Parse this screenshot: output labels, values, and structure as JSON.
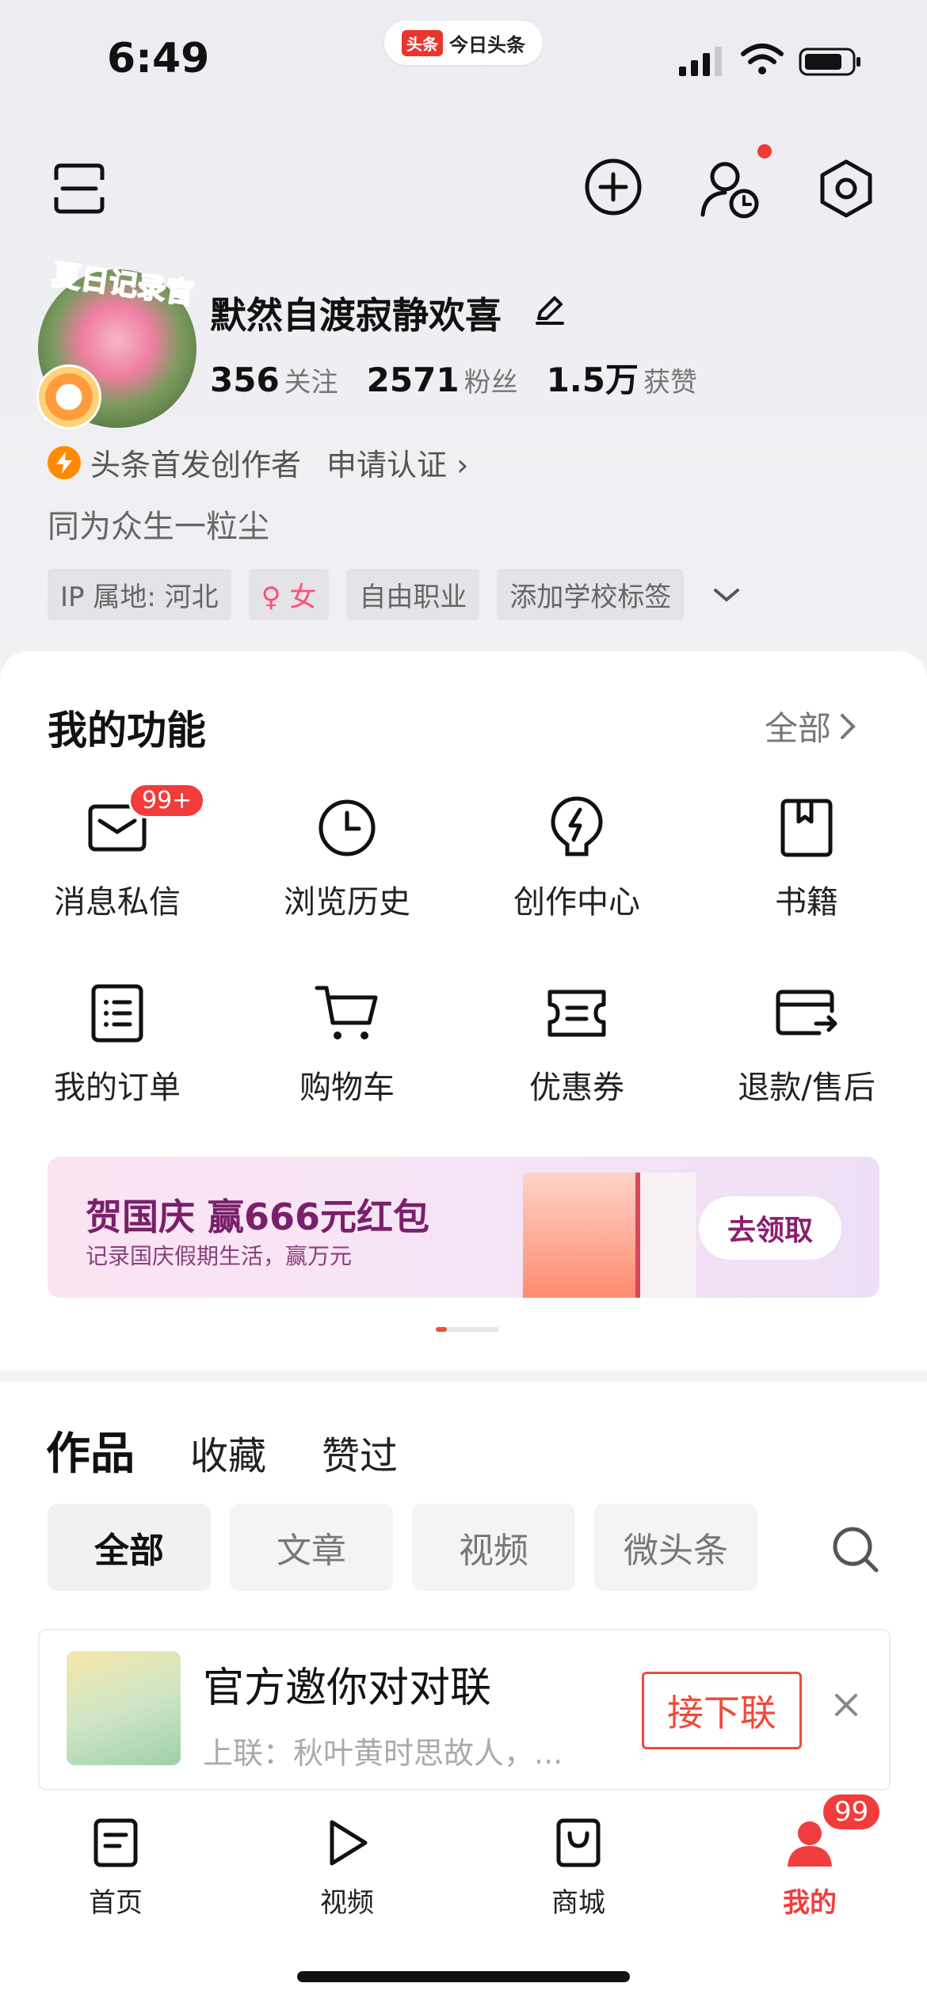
{
  "status_bar": {
    "time": "6:49",
    "app_badge": "头条",
    "app_name": "今日头条"
  },
  "profile": {
    "avatar_text": "夏日记录官",
    "username": "默然自渡寂静欢喜",
    "stats": [
      {
        "value": "356",
        "label": "关注"
      },
      {
        "value": "2571",
        "label": "粉丝"
      },
      {
        "value": "1.5万",
        "label": "获赞"
      }
    ],
    "creator_label": "头条首发创作者",
    "apply_label": "申请认证",
    "bio": "同为众生一粒尘",
    "tags": [
      "IP 属地: 河北",
      "♀ 女",
      "自由职业",
      "添加学校标签"
    ]
  },
  "functions": {
    "title": "我的功能",
    "all_label": "全部",
    "items": [
      {
        "label": "消息私信",
        "icon": "message-icon",
        "badge": "99+"
      },
      {
        "label": "浏览历史",
        "icon": "clock-icon"
      },
      {
        "label": "创作中心",
        "icon": "bolt-bulb-icon"
      },
      {
        "label": "书籍",
        "icon": "book-icon"
      },
      {
        "label": "我的订单",
        "icon": "order-list-icon"
      },
      {
        "label": "购物车",
        "icon": "cart-icon"
      },
      {
        "label": "优惠券",
        "icon": "coupon-icon"
      },
      {
        "label": "退款/售后",
        "icon": "refund-card-icon"
      }
    ]
  },
  "banner": {
    "title": "贺国庆 赢666元红包",
    "subtitle": "记录国庆假期生活，赢万元",
    "button": "去领取"
  },
  "works": {
    "tabs": [
      "作品",
      "收藏",
      "赞过"
    ],
    "filters": [
      "全部",
      "文章",
      "视频",
      "微头条"
    ],
    "active_filter": "全部"
  },
  "promo": {
    "title": "官方邀你对对联",
    "subtitle": "上联：秋叶黄时思故人，...",
    "button": "接下联"
  },
  "bottom_nav": {
    "items": [
      {
        "label": "首页",
        "icon": "home-doc-icon"
      },
      {
        "label": "视频",
        "icon": "play-icon"
      },
      {
        "label": "商城",
        "icon": "shop-bag-icon"
      },
      {
        "label": "我的",
        "icon": "person-icon",
        "active": true
      }
    ],
    "badge": "99"
  },
  "colors": {
    "accent_red": "#f03e3e",
    "banner_purple": "#7a1f6a",
    "creator_orange": "#ff8a00"
  }
}
